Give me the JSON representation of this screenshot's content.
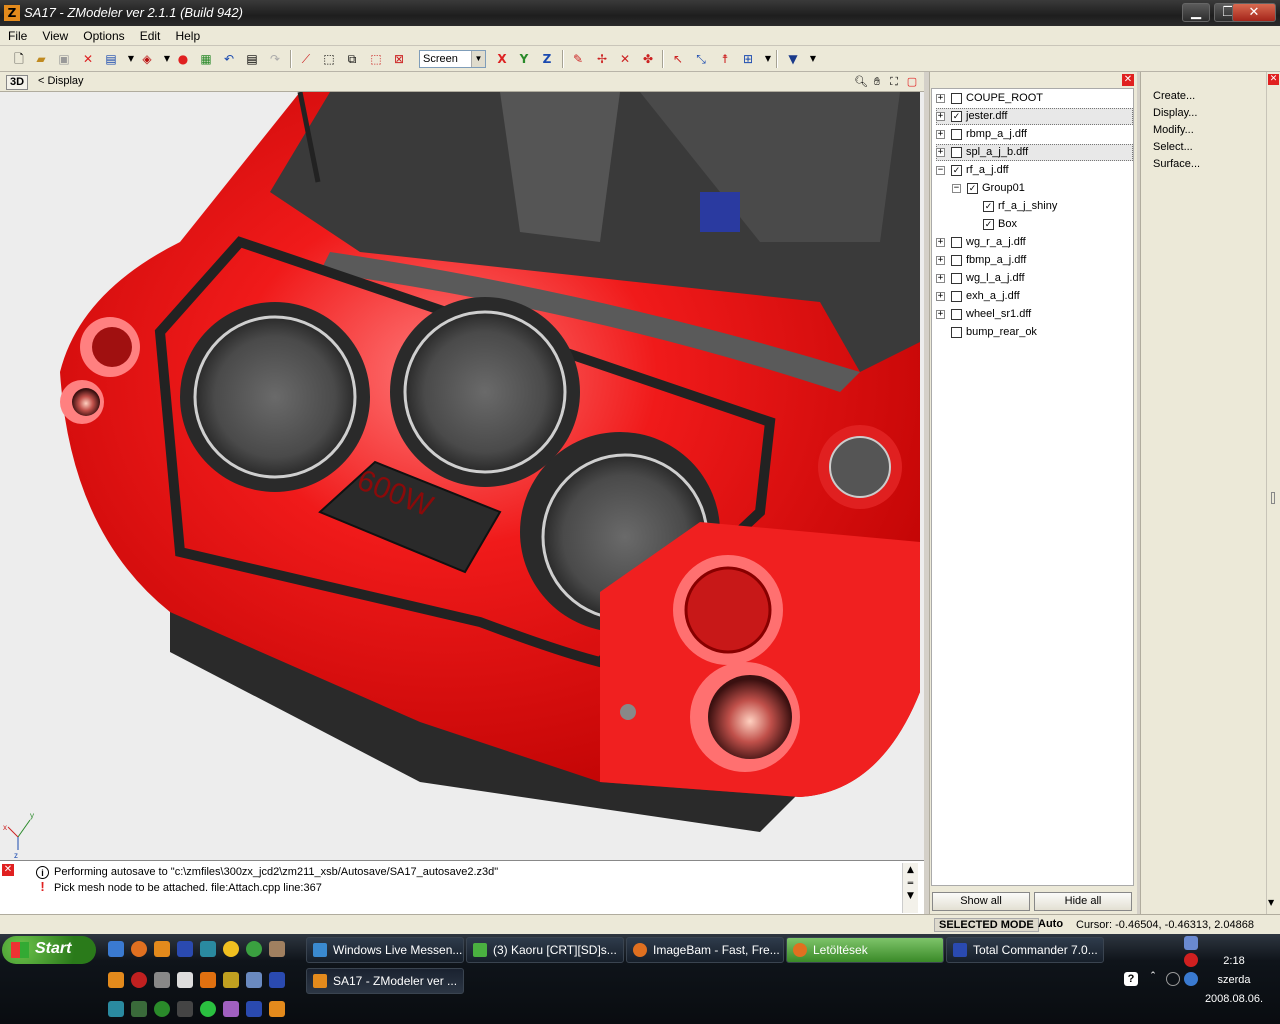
{
  "window": {
    "title": "SA17 - ZModeler ver 2.1.1 (Build 942)",
    "app_icon": "Z",
    "minimize": "▁",
    "maximize": "❐",
    "close": "✕"
  },
  "menu": [
    {
      "label": "File"
    },
    {
      "label": "View"
    },
    {
      "label": "Options"
    },
    {
      "label": "Edit"
    },
    {
      "label": "Help"
    }
  ],
  "toolbar": {
    "coord_system": "Screen",
    "axis_x": "X",
    "axis_y": "Y",
    "axis_z": "Z",
    "icons": [
      "new-icon",
      "open-icon",
      "save-icon",
      "delete-icon",
      "import-icon",
      "export-icon",
      "record-icon",
      "image-icon",
      "undo-icon",
      "document-icon",
      "redo-icon",
      "vertex-icon",
      "box-icon",
      "box-multiple-icon",
      "box-rotate-icon",
      "box-select-icon",
      "x-axis-icon",
      "y-axis-icon",
      "z-axis-icon",
      "tool-icon",
      "move-icon",
      "rotate-icon",
      "scale-icon",
      "pick-icon",
      "link-icon",
      "figure-icon",
      "hierarchy-icon",
      "helmet-icon"
    ]
  },
  "viewport": {
    "mode": "3D",
    "display_label": "< Display",
    "speaker_label": "600W",
    "axis_x": "x",
    "axis_y": "y",
    "axis_z": "z"
  },
  "tree": {
    "nodes": [
      {
        "label": "COUPE_ROOT",
        "checked": false,
        "expander": "+",
        "level": 0
      },
      {
        "label": "jester.dff",
        "checked": true,
        "expander": "+",
        "level": 0,
        "highlight": true
      },
      {
        "label": "rbmp_a_j.dff",
        "checked": false,
        "expander": "+",
        "level": 0
      },
      {
        "label": "spl_a_j_b.dff",
        "checked": false,
        "expander": "+",
        "level": 0,
        "highlight": true
      },
      {
        "label": "rf_a_j.dff",
        "checked": true,
        "expander": "−",
        "level": 0
      },
      {
        "label": "Group01",
        "checked": true,
        "expander": "−",
        "level": 1
      },
      {
        "label": "rf_a_j_shiny",
        "checked": true,
        "expander": "",
        "level": 2
      },
      {
        "label": "Box",
        "checked": true,
        "expander": "",
        "level": 2
      },
      {
        "label": "wg_r_a_j.dff",
        "checked": false,
        "expander": "+",
        "level": 0
      },
      {
        "label": "fbmp_a_j.dff",
        "checked": false,
        "expander": "+",
        "level": 0
      },
      {
        "label": "wg_l_a_j.dff",
        "checked": false,
        "expander": "+",
        "level": 0
      },
      {
        "label": "exh_a_j.dff",
        "checked": false,
        "expander": "+",
        "level": 0
      },
      {
        "label": "wheel_sr1.dff",
        "checked": false,
        "expander": "+",
        "level": 0
      },
      {
        "label": "bump_rear_ok",
        "checked": false,
        "expander": "",
        "level": 0
      }
    ],
    "show_all": "Show all",
    "hide_all": "Hide all"
  },
  "commands": [
    {
      "label": "Create..."
    },
    {
      "label": "Display..."
    },
    {
      "label": "Modify..."
    },
    {
      "label": "Select..."
    },
    {
      "label": "Surface..."
    }
  ],
  "log": [
    {
      "icon": "info-icon",
      "text": "Performing autosave to \"c:\\zmfiles\\300zx_jcd2\\zm211_xsb/Autosave/SA17_autosave2.z3d\""
    },
    {
      "icon": "error-icon",
      "text": "Pick mesh node to be attached. file:Attach.cpp line:367"
    }
  ],
  "status": {
    "mode": "SELECTED MODE",
    "auto": "Auto",
    "cursor": "Cursor: -0.46504, -0.46313, 2.04868"
  },
  "taskbar": {
    "start": "Start",
    "tasks_row1": [
      {
        "label": "Windows Live Messen...",
        "icon": "messenger-icon"
      },
      {
        "label": "(3) Kaoru [CRT][SD]s...",
        "icon": "chat-icon"
      },
      {
        "label": "ImageBam - Fast, Fre...",
        "icon": "firefox-icon"
      },
      {
        "label": "Letöltések",
        "icon": "download-icon",
        "active": true
      },
      {
        "label": "Total Commander 7.0...",
        "icon": "disk-icon"
      }
    ],
    "tasks_row2": [
      {
        "label": "SA17 - ZModeler ver ...",
        "icon": "zmodeler-icon",
        "pressed": true
      }
    ],
    "clock": {
      "time": "2:18",
      "day": "szerda",
      "date": "2008.08.06."
    }
  },
  "colors": {
    "car_red": "#e81010",
    "panel_bg": "#ece9d8",
    "viewport_bg": "#ededed",
    "taskbar_bg": "#0f141a"
  }
}
